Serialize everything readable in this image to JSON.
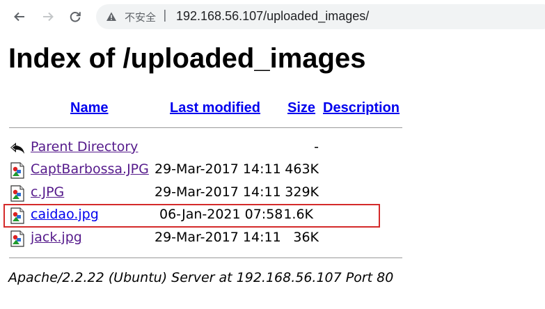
{
  "browser": {
    "insecure_label": "不安全",
    "separator": "|",
    "url": "192.168.56.107/uploaded_images/"
  },
  "page": {
    "title": "Index of /uploaded_images",
    "columns": {
      "name": "Name",
      "last_modified": "Last modified",
      "size": "Size",
      "description": "Description"
    },
    "rows": [
      {
        "name": "Parent Directory",
        "modified": "",
        "size": "-",
        "icon": "back-icon"
      },
      {
        "name": "CaptBarbossa.JPG",
        "modified": "29-Mar-2017 14:11",
        "size": "463K",
        "icon": "image-file-icon"
      },
      {
        "name": "c.JPG",
        "modified": "29-Mar-2017 14:11",
        "size": "329K",
        "icon": "image-file-icon"
      },
      {
        "name": "caidao.jpg",
        "modified": "06-Jan-2021 07:58",
        "size": "1.6K",
        "icon": "image-file-icon",
        "highlighted": true
      },
      {
        "name": "jack.jpg",
        "modified": "29-Mar-2017 14:11",
        "size": "36K",
        "icon": "image-file-icon"
      }
    ],
    "address": "Apache/2.2.22 (Ubuntu) Server at 192.168.56.107 Port 80"
  },
  "colors": {
    "link": "#0000ee",
    "visited_link": "#551a8b",
    "highlight_border": "#d42a2a"
  }
}
